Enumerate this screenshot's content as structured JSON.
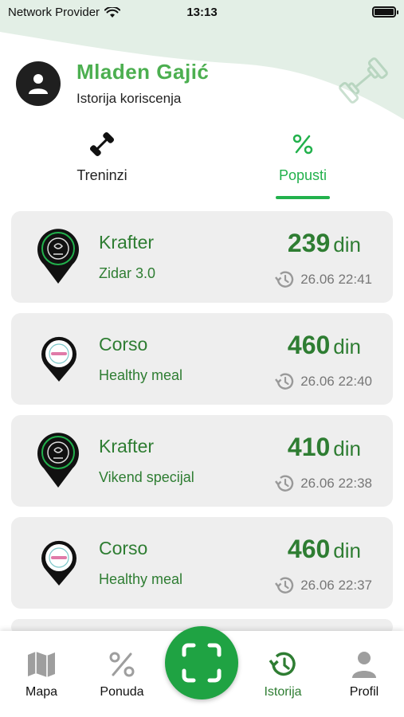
{
  "status_bar": {
    "carrier": "Network Provider",
    "time": "13:13"
  },
  "user": {
    "name": "Mladen Gajić",
    "subtitle": "Istorija koriscenja"
  },
  "tabs": [
    {
      "label": "Treninzi",
      "icon": "dumbbell-icon",
      "active": false
    },
    {
      "label": "Popusti",
      "icon": "percent-icon",
      "active": true
    }
  ],
  "history": [
    {
      "venue": "Krafter",
      "deal": "Zidar 3.0",
      "amount": "239",
      "currency": "din",
      "datetime": "26.06 22:41",
      "logo": "krafter"
    },
    {
      "venue": "Corso",
      "deal": "Healthy meal",
      "amount": "460",
      "currency": "din",
      "datetime": "26.06 22:40",
      "logo": "corso"
    },
    {
      "venue": "Krafter",
      "deal": "Vikend specijal",
      "amount": "410",
      "currency": "din",
      "datetime": "26.06 22:38",
      "logo": "krafter"
    },
    {
      "venue": "Corso",
      "deal": "Healthy meal",
      "amount": "460",
      "currency": "din",
      "datetime": "26.06 22:37",
      "logo": "corso"
    }
  ],
  "bottom_nav": [
    {
      "label": "Mapa",
      "icon": "map-icon",
      "active": false
    },
    {
      "label": "Ponuda",
      "icon": "percent-icon",
      "active": false
    },
    {
      "label": "Istorija",
      "icon": "history-icon",
      "active": true
    },
    {
      "label": "Profil",
      "icon": "person-icon",
      "active": false
    }
  ],
  "scan_button": {
    "icon": "scan-icon"
  },
  "colors": {
    "accent": "#22b14c",
    "price_green": "#2e7d32",
    "card_bg": "#eeeeee",
    "header_bg": "#e3efe6"
  }
}
